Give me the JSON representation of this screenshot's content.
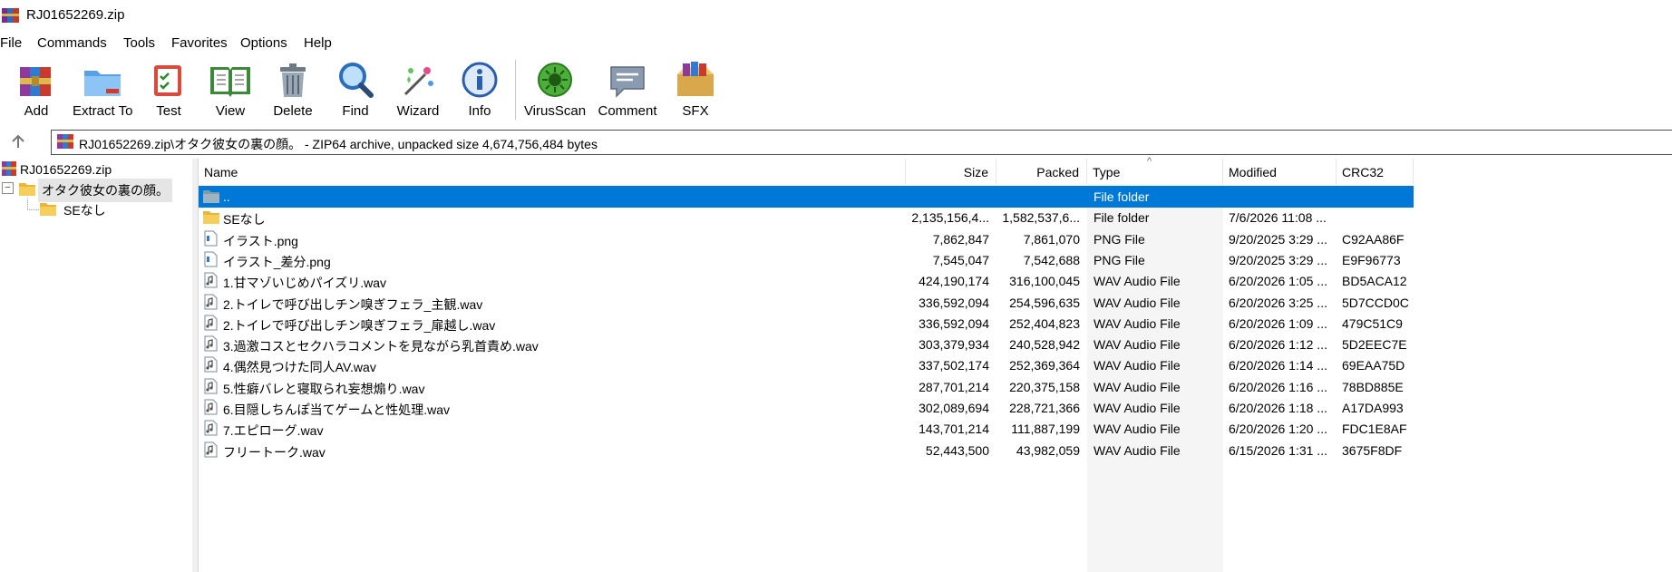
{
  "window": {
    "title": "RJ01652269.zip"
  },
  "menu": [
    "File",
    "Commands",
    "Tools",
    "Favorites",
    "Options",
    "Help"
  ],
  "toolbar": {
    "add": "Add",
    "extract": "Extract To",
    "test": "Test",
    "view": "View",
    "delete": "Delete",
    "find": "Find",
    "wizard": "Wizard",
    "info": "Info",
    "virusscan": "VirusScan",
    "comment": "Comment",
    "sfx": "SFX"
  },
  "address": {
    "text": "RJ01652269.zip\\オタク彼女の裏の顔。 - ZIP64 archive, unpacked size 4,674,756,484 bytes"
  },
  "tree": {
    "root": "RJ01652269.zip",
    "folder": "オタク彼女の裏の顔。",
    "child": "SEなし"
  },
  "columns": {
    "name": "Name",
    "size": "Size",
    "packed": "Packed",
    "type": "Type",
    "modified": "Modified",
    "crc": "CRC32"
  },
  "files": [
    {
      "name": "..",
      "size": "",
      "packed": "",
      "type": "File folder",
      "modified": "",
      "crc": "",
      "icon": "parent-folder-icon"
    },
    {
      "name": "SEなし",
      "size": "2,135,156,4...",
      "packed": "1,582,537,6...",
      "type": "File folder",
      "modified": "7/6/2026 11:08 ...",
      "crc": "",
      "icon": "folder-icon"
    },
    {
      "name": "イラスト.png",
      "size": "7,862,847",
      "packed": "7,861,070",
      "type": "PNG File",
      "modified": "9/20/2025 3:29 ...",
      "crc": "C92AA86F",
      "icon": "image-file-icon"
    },
    {
      "name": "イラスト_差分.png",
      "size": "7,545,047",
      "packed": "7,542,688",
      "type": "PNG File",
      "modified": "9/20/2025 3:29 ...",
      "crc": "E9F96773",
      "icon": "image-file-icon"
    },
    {
      "name": "1.甘マゾいじめパイズリ.wav",
      "size": "424,190,174",
      "packed": "316,100,045",
      "type": "WAV Audio File",
      "modified": "6/20/2026 1:05 ...",
      "crc": "BD5ACA12",
      "icon": "audio-file-icon"
    },
    {
      "name": "2.トイレで呼び出しチン嗅ぎフェラ_主観.wav",
      "size": "336,592,094",
      "packed": "254,596,635",
      "type": "WAV Audio File",
      "modified": "6/20/2026 3:25 ...",
      "crc": "5D7CCD0C",
      "icon": "audio-file-icon"
    },
    {
      "name": "2.トイレで呼び出しチン嗅ぎフェラ_扉越し.wav",
      "size": "336,592,094",
      "packed": "252,404,823",
      "type": "WAV Audio File",
      "modified": "6/20/2026 1:09 ...",
      "crc": "479C51C9",
      "icon": "audio-file-icon"
    },
    {
      "name": "3.過激コスとセクハラコメントを見ながら乳首責め.wav",
      "size": "303,379,934",
      "packed": "240,528,942",
      "type": "WAV Audio File",
      "modified": "6/20/2026 1:12 ...",
      "crc": "5D2EEC7E",
      "icon": "audio-file-icon"
    },
    {
      "name": "4.偶然見つけた同人AV.wav",
      "size": "337,502,174",
      "packed": "252,369,364",
      "type": "WAV Audio File",
      "modified": "6/20/2026 1:14 ...",
      "crc": "69EAA75D",
      "icon": "audio-file-icon"
    },
    {
      "name": "5.性癖バレと寝取られ妄想煽り.wav",
      "size": "287,701,214",
      "packed": "220,375,158",
      "type": "WAV Audio File",
      "modified": "6/20/2026 1:16 ...",
      "crc": "78BD885E",
      "icon": "audio-file-icon"
    },
    {
      "name": "6.目隠しちんぽ当てゲームと性処理.wav",
      "size": "302,089,694",
      "packed": "228,721,366",
      "type": "WAV Audio File",
      "modified": "6/20/2026 1:18 ...",
      "crc": "A17DA993",
      "icon": "audio-file-icon"
    },
    {
      "name": "7.エピローグ.wav",
      "size": "143,701,214",
      "packed": "111,887,199",
      "type": "WAV Audio File",
      "modified": "6/20/2026 1:20 ...",
      "crc": "FDC1E8AF",
      "icon": "audio-file-icon"
    },
    {
      "name": "フリートーク.wav",
      "size": "52,443,500",
      "packed": "43,982,059",
      "type": "WAV Audio File",
      "modified": "6/15/2026 1:31 ...",
      "crc": "3675F8DF",
      "icon": "audio-file-icon"
    }
  ],
  "colors": {
    "selection": "#0078d7",
    "typeColumn": "#f5f5f5"
  }
}
